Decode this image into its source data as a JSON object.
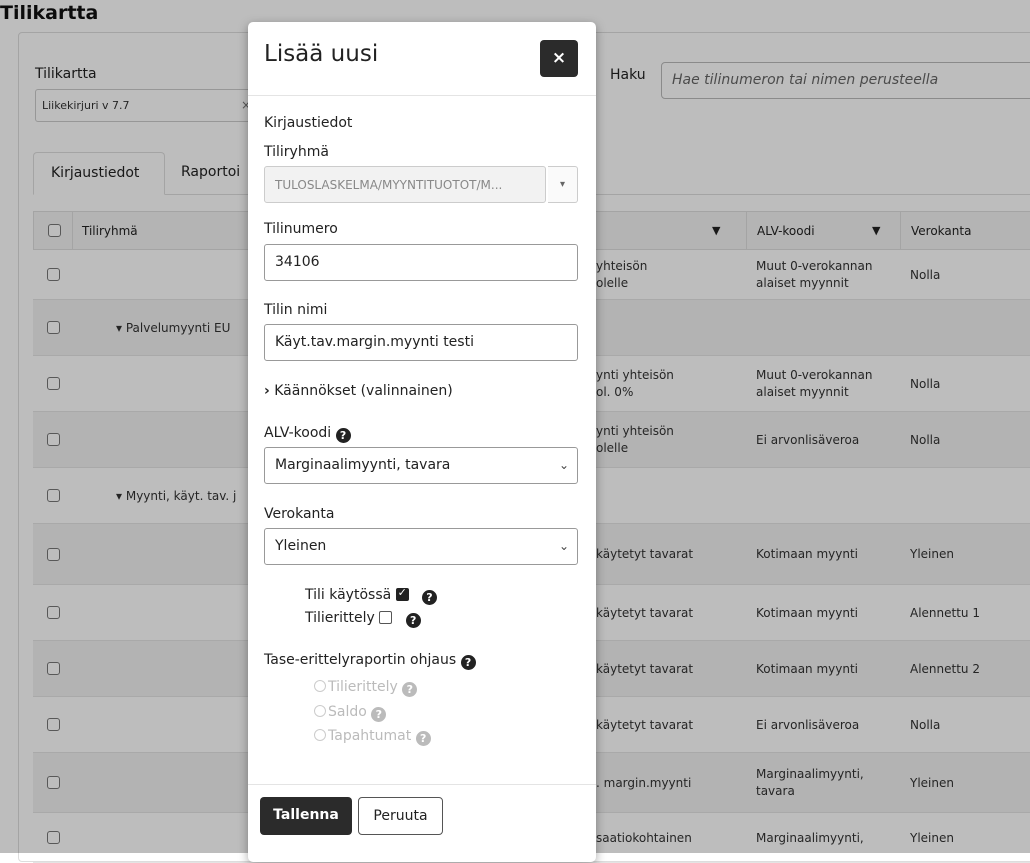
{
  "page": {
    "title": "Tilikartta",
    "chart_label": "Tilikartta",
    "chart_value": "Liikekirjuri v 7.7",
    "clear_icon": "×",
    "search_label": "Haku",
    "search_placeholder": "Hae tilinumeron tai nimen perusteella",
    "tabs": [
      "Kirjaustiedot",
      "Raportoi"
    ]
  },
  "grid": {
    "headers": {
      "group": "Tiliryhmä",
      "alv": "ALV-koodi",
      "rate": "Verokanta"
    },
    "rows": [
      {
        "group": "",
        "name": [
          "yhteisön",
          "olelle"
        ],
        "alv": [
          "Muut 0-verokannan",
          "alaiset myynnit"
        ],
        "rate": "Nolla"
      },
      {
        "group": "▾ Palvelumyynti EU",
        "name": [],
        "alv": [],
        "rate": ""
      },
      {
        "group": "",
        "name": [
          "ynti yhteisön",
          "ol. 0%"
        ],
        "alv": [
          "Muut 0-verokannan",
          "alaiset myynnit"
        ],
        "rate": "Nolla"
      },
      {
        "group": "",
        "name": [
          "ynti yhteisön",
          "olelle"
        ],
        "alv": [
          "Ei arvonlisäveroa"
        ],
        "rate": "Nolla"
      },
      {
        "group": "▾ Myynti, käyt. tav. j",
        "name": [],
        "alv": [],
        "rate": ""
      },
      {
        "group": "",
        "name": [
          "käytetyt tavarat"
        ],
        "alv": [
          "Kotimaan myynti"
        ],
        "rate": "Yleinen"
      },
      {
        "group": "",
        "name": [
          "käytetyt tavarat"
        ],
        "alv": [
          "Kotimaan myynti"
        ],
        "rate": "Alennettu 1"
      },
      {
        "group": "",
        "name": [
          "käytetyt tavarat"
        ],
        "alv": [
          "Kotimaan myynti"
        ],
        "rate": "Alennettu 2"
      },
      {
        "group": "",
        "name": [
          "käytetyt tavarat"
        ],
        "alv": [
          "Ei arvonlisäveroa"
        ],
        "rate": "Nolla"
      },
      {
        "group": "",
        "name": [
          ". margin.myynti"
        ],
        "alv": [
          "Marginaalimyynti,",
          "tavara"
        ],
        "rate": "Yleinen"
      },
      {
        "group": "",
        "name": [
          "saatiokohtainen"
        ],
        "alv": [
          "Marginaalimyynti,"
        ],
        "rate": "Yleinen"
      }
    ]
  },
  "modal": {
    "title": "Lisää uusi",
    "close_label": "×",
    "section": "Kirjaustiedot",
    "group_label": "Tiliryhmä",
    "group_value": "TULOSLASKELMA/MYYNTITUOTOT/M...",
    "dropdown_caret": "▾",
    "number_label": "Tilinumero",
    "number_value": "34106",
    "name_label": "Tilin nimi",
    "name_value": "Käyt.tav.margin.myynti testi",
    "translations_label": "Käännökset (valinnainen)",
    "alv_label": "ALV-koodi",
    "alv_value": "Marginaalimyynti, tavara",
    "rate_label": "Verokanta",
    "rate_value": "Yleinen",
    "in_use_label": "Tili käytössä",
    "in_use_checked": true,
    "itemization_label": "Tilierittely",
    "itemization_checked": false,
    "report_label": "Tase-erittelyraportin ohjaus",
    "report_options": [
      "Tilierittely",
      "Saldo",
      "Tapahtumat"
    ],
    "save_label": "Tallenna",
    "cancel_label": "Peruuta",
    "help_glyph": "?",
    "chevron_glyph": "›",
    "select_glyph": "⌄"
  }
}
